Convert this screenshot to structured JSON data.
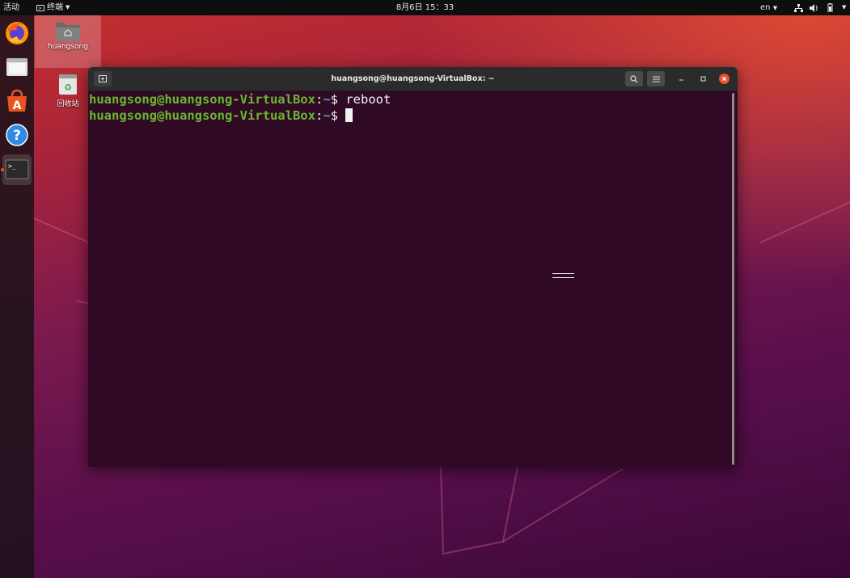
{
  "topbar": {
    "activities": "活动",
    "app_menu_label": "终端",
    "clock": "8月6日  15：33",
    "language": "en",
    "icons": [
      "network-icon",
      "volume-icon",
      "battery-icon",
      "system-menu-arrow-icon"
    ]
  },
  "dock": {
    "items": [
      "firefox-icon",
      "files-icon",
      "software-icon",
      "help-icon",
      "terminal-icon"
    ]
  },
  "desktop": {
    "icons": [
      {
        "label": "huangsong",
        "icon": "home-folder-icon"
      },
      {
        "label": "回收站",
        "icon": "trash-icon"
      }
    ]
  },
  "terminal": {
    "title": "huangsong@huangsong-VirtualBox: ~",
    "lines": [
      {
        "user_host": "huangsong@huangsong-VirtualBox",
        "sep": ":",
        "path": "~",
        "prompt": "$ ",
        "command": "reboot"
      },
      {
        "user_host": "huangsong@huangsong-VirtualBox",
        "sep": ":",
        "path": "~",
        "prompt": "$ ",
        "command": ""
      }
    ]
  },
  "colors": {
    "prompt_user": "#6ab72f",
    "prompt_path": "#5f8fd6",
    "terminal_bg": "#300a24",
    "close_button": "#e9532e"
  }
}
